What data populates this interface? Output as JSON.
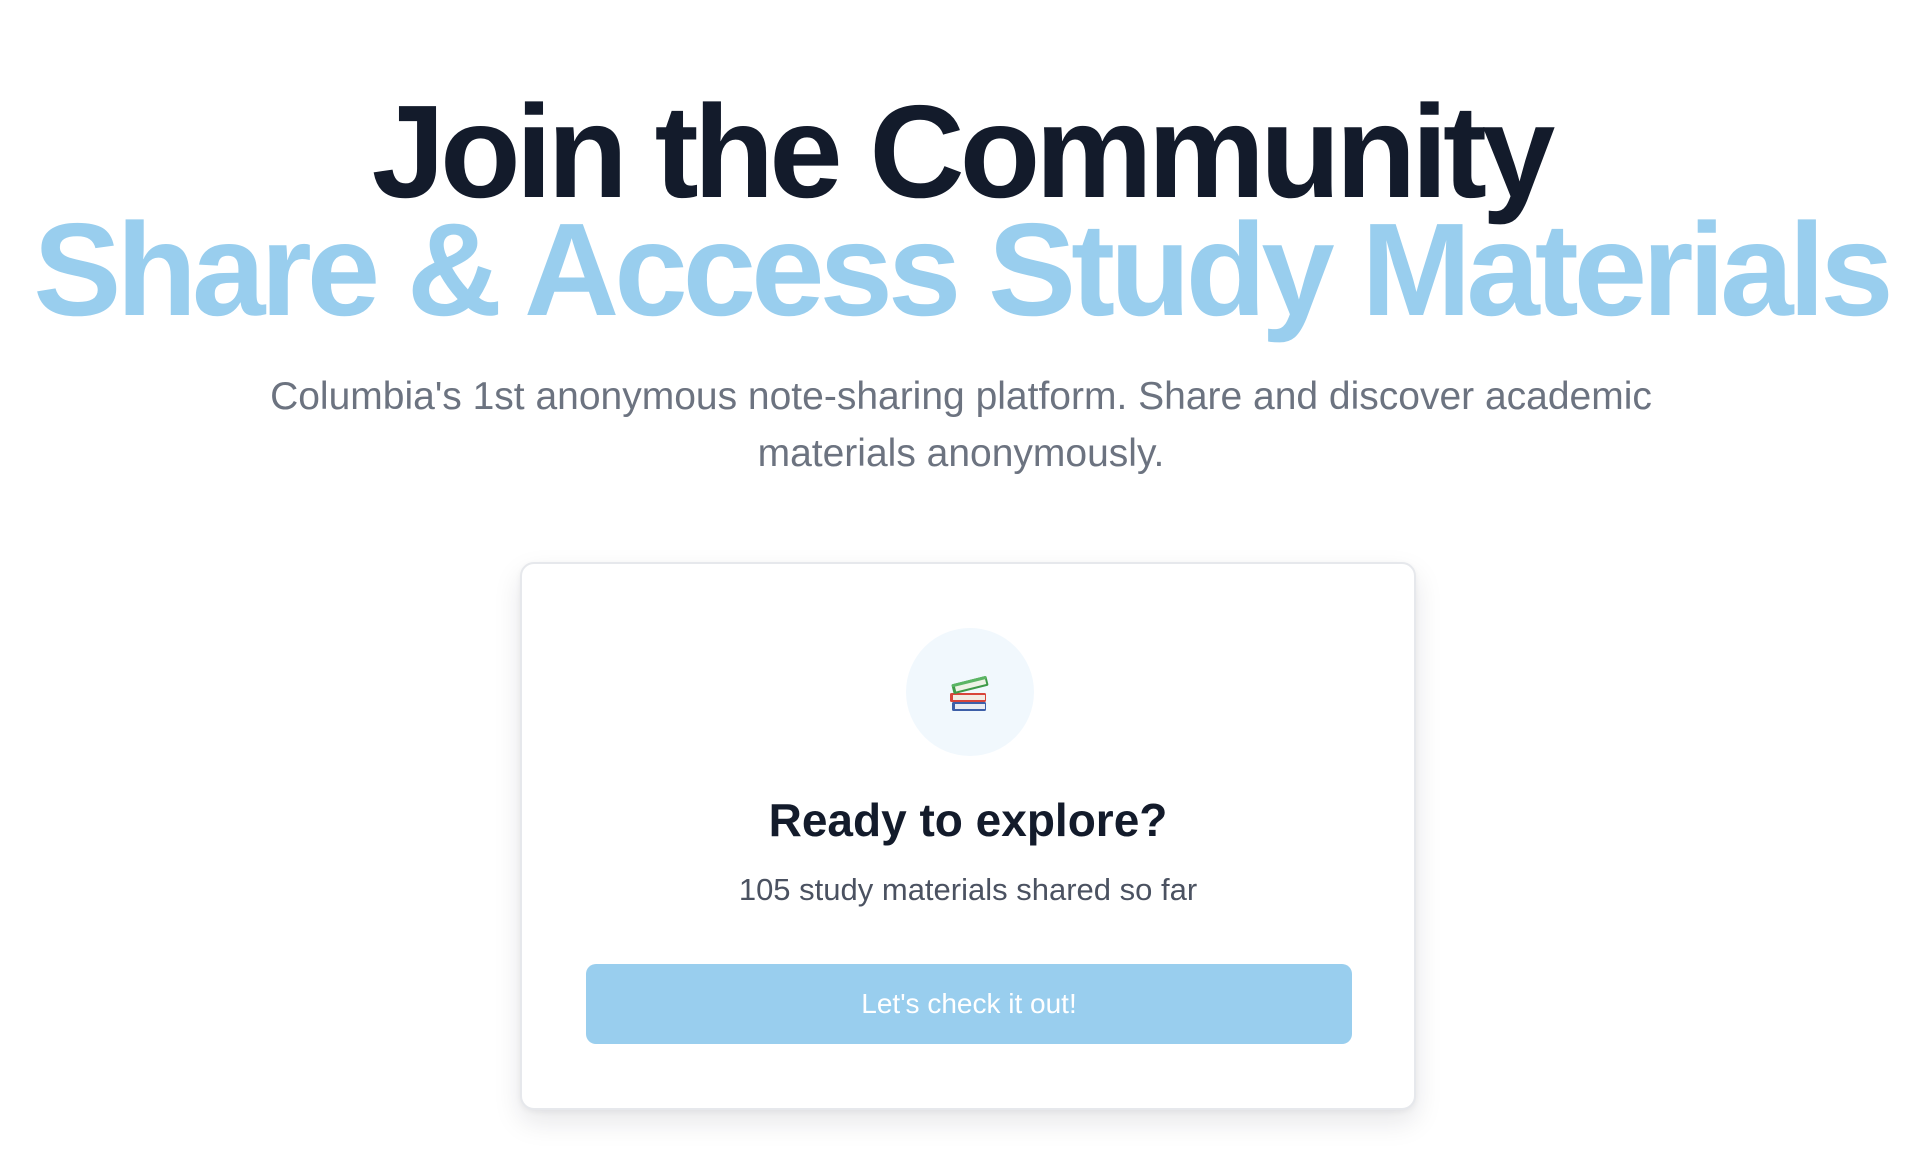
{
  "hero": {
    "title_line1": "Join the Community",
    "title_line2": "Share & Access Study Materials",
    "subtitle": "Columbia's 1st anonymous note-sharing platform. Share and discover academic materials anonymously."
  },
  "card": {
    "icon": "books-icon",
    "title": "Ready to explore?",
    "stat": "105 study materials shared so far",
    "button_label": "Let's check it out!"
  },
  "colors": {
    "title_dark": "#131b2b",
    "accent": "#99ceee",
    "subtitle_gray": "#6c7380",
    "card_border": "#e6e8ec",
    "icon_bg": "#f1f8fd"
  }
}
